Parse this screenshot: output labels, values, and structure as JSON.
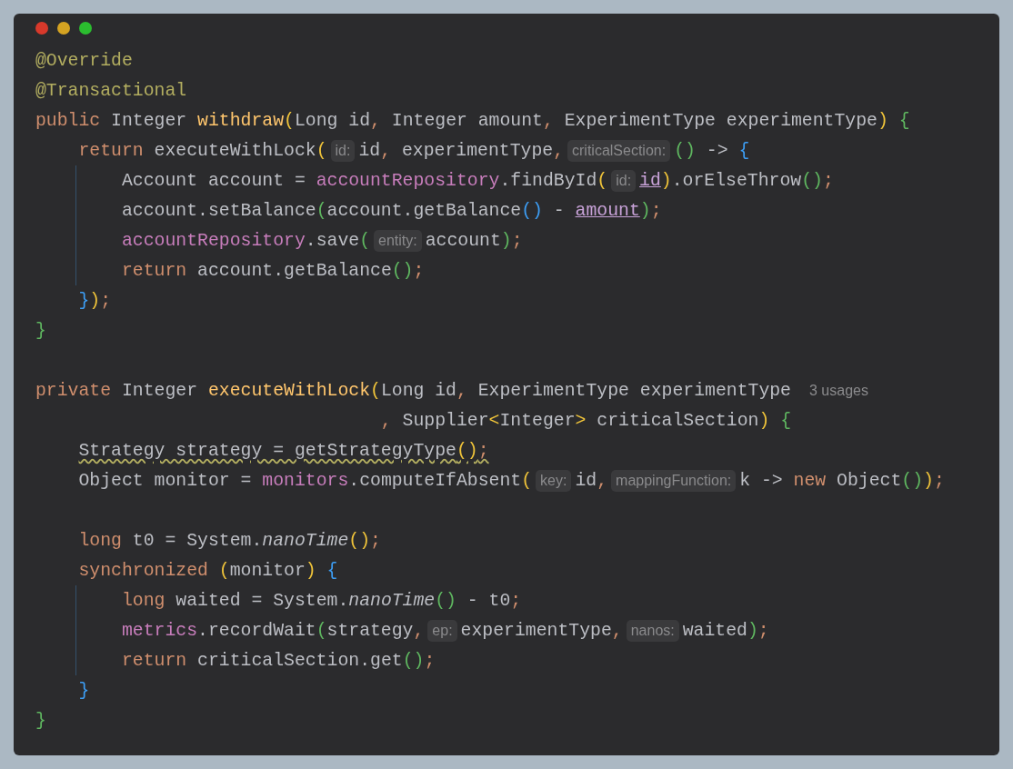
{
  "lines": [
    {
      "kind": "code",
      "guide": false,
      "parts": [
        {
          "kind": "annotation",
          "text": "@Override"
        }
      ]
    },
    {
      "kind": "code",
      "guide": false,
      "parts": [
        {
          "kind": "annotation",
          "text": "@Transactional"
        }
      ]
    },
    {
      "kind": "code",
      "guide": false,
      "parts": [
        {
          "kind": "keyword",
          "text": "public"
        },
        {
          "kind": "plain",
          "text": " Integer "
        },
        {
          "kind": "declaration",
          "text": "withdraw"
        },
        {
          "kind": "paren1",
          "text": "("
        },
        {
          "kind": "plain",
          "text": "Long id"
        },
        {
          "kind": "punct",
          "text": ","
        },
        {
          "kind": "plain",
          "text": " Integer amount"
        },
        {
          "kind": "punct",
          "text": ","
        },
        {
          "kind": "plain",
          "text": " ExperimentType experimentType"
        },
        {
          "kind": "paren1",
          "text": ") "
        },
        {
          "kind": "paren2",
          "text": "{"
        }
      ]
    },
    {
      "kind": "code",
      "guide": false,
      "parts": [
        {
          "kind": "keyword",
          "text": "    return"
        },
        {
          "kind": "plain",
          "text": " executeWithLock"
        },
        {
          "kind": "paren1",
          "text": "("
        },
        {
          "kind": "hint",
          "text": "id:"
        },
        {
          "kind": "plain",
          "text": "id"
        },
        {
          "kind": "punct",
          "text": ","
        },
        {
          "kind": "plain",
          "text": " experimentType"
        },
        {
          "kind": "punct",
          "text": ","
        },
        {
          "kind": "hint",
          "text": "criticalSection:"
        },
        {
          "kind": "paren2",
          "text": "()"
        },
        {
          "kind": "plain",
          "text": " -> "
        },
        {
          "kind": "paren3",
          "text": "{"
        }
      ]
    },
    {
      "kind": "code",
      "guide": true,
      "parts": [
        {
          "kind": "plain",
          "text": "        Account account = "
        },
        {
          "kind": "field",
          "text": "accountRepository"
        },
        {
          "kind": "plain",
          "text": ".findById"
        },
        {
          "kind": "paren1",
          "text": "("
        },
        {
          "kind": "hint",
          "text": "id:"
        },
        {
          "kind": "param",
          "text": "id"
        },
        {
          "kind": "paren1",
          "text": ")"
        },
        {
          "kind": "plain",
          "text": ".orElseThrow"
        },
        {
          "kind": "paren2",
          "text": "()"
        },
        {
          "kind": "punct",
          "text": ";"
        }
      ]
    },
    {
      "kind": "code",
      "guide": true,
      "parts": [
        {
          "kind": "plain",
          "text": "        account.setBalance"
        },
        {
          "kind": "paren2",
          "text": "("
        },
        {
          "kind": "plain",
          "text": "account.getBalance"
        },
        {
          "kind": "paren3",
          "text": "()"
        },
        {
          "kind": "plain",
          "text": " - "
        },
        {
          "kind": "param",
          "text": "amount"
        },
        {
          "kind": "paren2",
          "text": ")"
        },
        {
          "kind": "punct",
          "text": ";"
        }
      ]
    },
    {
      "kind": "code",
      "guide": true,
      "parts": [
        {
          "kind": "field",
          "text": "        accountRepository"
        },
        {
          "kind": "plain",
          "text": ".save"
        },
        {
          "kind": "paren2",
          "text": "("
        },
        {
          "kind": "hint",
          "text": "entity:"
        },
        {
          "kind": "plain",
          "text": "account"
        },
        {
          "kind": "paren2",
          "text": ")"
        },
        {
          "kind": "punct",
          "text": ";"
        }
      ]
    },
    {
      "kind": "code",
      "guide": true,
      "parts": [
        {
          "kind": "keyword",
          "text": "        return"
        },
        {
          "kind": "plain",
          "text": " account.getBalance"
        },
        {
          "kind": "paren2",
          "text": "()"
        },
        {
          "kind": "punct",
          "text": ";"
        }
      ]
    },
    {
      "kind": "code",
      "guide": false,
      "parts": [
        {
          "kind": "paren3",
          "text": "    }"
        },
        {
          "kind": "paren1",
          "text": ")"
        },
        {
          "kind": "punct",
          "text": ";"
        }
      ]
    },
    {
      "kind": "code",
      "guide": false,
      "parts": [
        {
          "kind": "paren2",
          "text": "}"
        }
      ]
    },
    {
      "kind": "blank",
      "guide": false
    },
    {
      "kind": "code",
      "guide": false,
      "parts": [
        {
          "kind": "keyword",
          "text": "private"
        },
        {
          "kind": "plain",
          "text": " Integer "
        },
        {
          "kind": "declaration",
          "text": "executeWithLock"
        },
        {
          "kind": "paren1",
          "text": "("
        },
        {
          "kind": "plain",
          "text": "Long id"
        },
        {
          "kind": "punct",
          "text": ","
        },
        {
          "kind": "plain",
          "text": " ExperimentType experimentType"
        },
        {
          "kind": "usage",
          "text": "3 usages"
        }
      ]
    },
    {
      "kind": "code",
      "guide": false,
      "parts": [
        {
          "kind": "punct",
          "text": "                                ,"
        },
        {
          "kind": "plain",
          "text": " Supplier"
        },
        {
          "kind": "paren1",
          "text": "<"
        },
        {
          "kind": "plain",
          "text": "Integer"
        },
        {
          "kind": "paren1",
          "text": ">"
        },
        {
          "kind": "plain",
          "text": " criticalSection"
        },
        {
          "kind": "paren1",
          "text": ") "
        },
        {
          "kind": "paren2",
          "text": "{"
        }
      ]
    },
    {
      "kind": "code",
      "guide": false,
      "parts": [
        {
          "kind": "plain",
          "text": "    Strategy strategy = getStrategyType",
          "warning": true
        },
        {
          "kind": "paren1",
          "text": "()",
          "warning": true
        },
        {
          "kind": "punct",
          "text": ";",
          "warning": true
        }
      ]
    },
    {
      "kind": "code",
      "guide": false,
      "parts": [
        {
          "kind": "plain",
          "text": "    Object monitor = "
        },
        {
          "kind": "field",
          "text": "monitors"
        },
        {
          "kind": "plain",
          "text": ".computeIfAbsent"
        },
        {
          "kind": "paren1",
          "text": "("
        },
        {
          "kind": "hint",
          "text": "key:"
        },
        {
          "kind": "plain",
          "text": "id"
        },
        {
          "kind": "punct",
          "text": ","
        },
        {
          "kind": "hint",
          "text": "mappingFunction:"
        },
        {
          "kind": "plain",
          "text": "k -> "
        },
        {
          "kind": "keyword",
          "text": "new"
        },
        {
          "kind": "plain",
          "text": " Object"
        },
        {
          "kind": "paren2",
          "text": "()"
        },
        {
          "kind": "paren1",
          "text": ")"
        },
        {
          "kind": "punct",
          "text": ";"
        }
      ]
    },
    {
      "kind": "blank",
      "guide": false
    },
    {
      "kind": "code",
      "guide": false,
      "parts": [
        {
          "kind": "keyword",
          "text": "    long"
        },
        {
          "kind": "plain",
          "text": " t0 = System."
        },
        {
          "kind": "italic",
          "text": "nanoTime"
        },
        {
          "kind": "paren1",
          "text": "()"
        },
        {
          "kind": "punct",
          "text": ";"
        }
      ]
    },
    {
      "kind": "code",
      "guide": false,
      "parts": [
        {
          "kind": "keyword",
          "text": "    synchronized "
        },
        {
          "kind": "paren1",
          "text": "("
        },
        {
          "kind": "plain",
          "text": "monitor"
        },
        {
          "kind": "paren1",
          "text": ") "
        },
        {
          "kind": "paren3",
          "text": "{"
        }
      ]
    },
    {
      "kind": "code",
      "guide": true,
      "parts": [
        {
          "kind": "keyword",
          "text": "        long"
        },
        {
          "kind": "plain",
          "text": " waited = System."
        },
        {
          "kind": "italic",
          "text": "nanoTime"
        },
        {
          "kind": "paren2",
          "text": "()"
        },
        {
          "kind": "plain",
          "text": " - t0"
        },
        {
          "kind": "punct",
          "text": ";"
        }
      ]
    },
    {
      "kind": "code",
      "guide": true,
      "parts": [
        {
          "kind": "field",
          "text": "        metrics"
        },
        {
          "kind": "plain",
          "text": ".recordWait"
        },
        {
          "kind": "paren2",
          "text": "("
        },
        {
          "kind": "plain",
          "text": "strategy"
        },
        {
          "kind": "punct",
          "text": ","
        },
        {
          "kind": "hint",
          "text": "ep:"
        },
        {
          "kind": "plain",
          "text": "experimentType"
        },
        {
          "kind": "punct",
          "text": ","
        },
        {
          "kind": "hint",
          "text": "nanos:"
        },
        {
          "kind": "plain",
          "text": "waited"
        },
        {
          "kind": "paren2",
          "text": ")"
        },
        {
          "kind": "punct",
          "text": ";"
        }
      ]
    },
    {
      "kind": "code",
      "guide": true,
      "parts": [
        {
          "kind": "keyword",
          "text": "        return"
        },
        {
          "kind": "plain",
          "text": " criticalSection.get"
        },
        {
          "kind": "paren2",
          "text": "()"
        },
        {
          "kind": "punct",
          "text": ";"
        }
      ]
    },
    {
      "kind": "code",
      "guide": false,
      "parts": [
        {
          "kind": "paren3",
          "text": "    }"
        }
      ]
    },
    {
      "kind": "code",
      "guide": false,
      "parts": [
        {
          "kind": "paren2",
          "text": "}"
        }
      ]
    }
  ]
}
